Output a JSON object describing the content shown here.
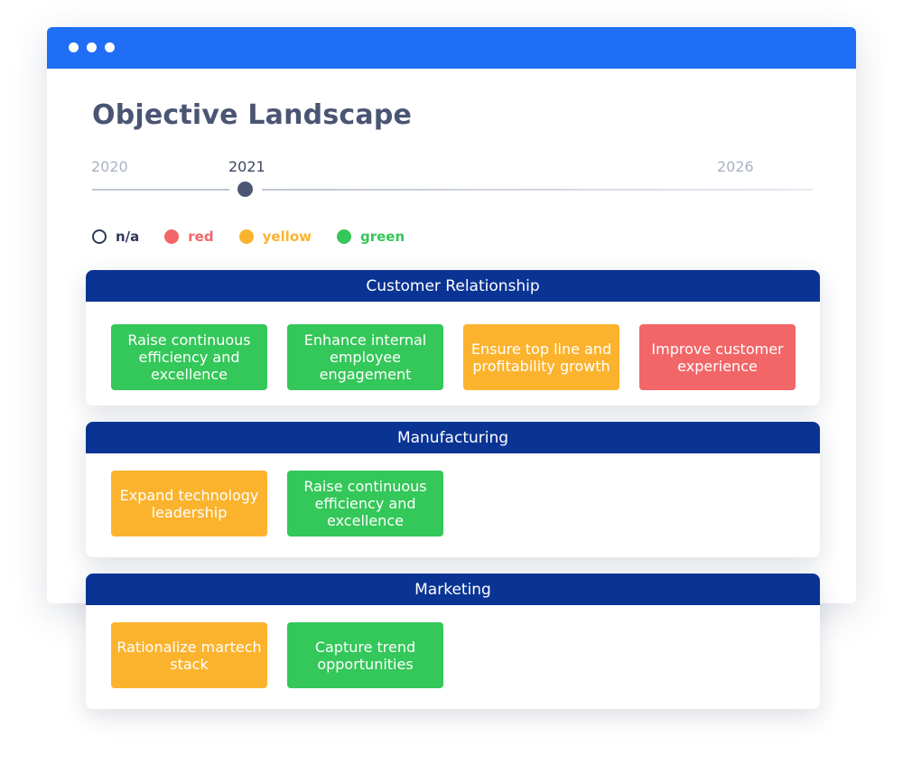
{
  "page": {
    "title": "Objective Landscape"
  },
  "timeline": {
    "years": [
      "2020",
      "2021",
      "2026"
    ],
    "selected": "2021"
  },
  "legend": {
    "items": [
      {
        "label": "n/a",
        "color": "#2f3a5c",
        "style": "outline"
      },
      {
        "label": "red",
        "color": "#f26668",
        "style": "filled"
      },
      {
        "label": "yellow",
        "color": "#fbb32e",
        "style": "filled"
      },
      {
        "label": "green",
        "color": "#34c759",
        "style": "filled"
      }
    ]
  },
  "status_colors": {
    "red": "#f26668",
    "yellow": "#fbb32e",
    "green": "#34c759"
  },
  "sections": [
    {
      "title": "Customer Relationship",
      "objectives": [
        {
          "label": "Raise continuous efficiency and excellence",
          "status": "green"
        },
        {
          "label": "Enhance internal employee engagement",
          "status": "green"
        },
        {
          "label": "Ensure top line and profitability growth",
          "status": "yellow"
        },
        {
          "label": "Improve customer experience",
          "status": "red"
        }
      ]
    },
    {
      "title": "Manufacturing",
      "objectives": [
        {
          "label": "Expand technology leadership",
          "status": "yellow"
        },
        {
          "label": "Raise continuous efficiency and excellence",
          "status": "green"
        }
      ]
    },
    {
      "title": "Marketing",
      "objectives": [
        {
          "label": "Rationalize martech stack",
          "status": "yellow"
        },
        {
          "label": "Capture trend opportunities",
          "status": "green"
        }
      ]
    }
  ]
}
